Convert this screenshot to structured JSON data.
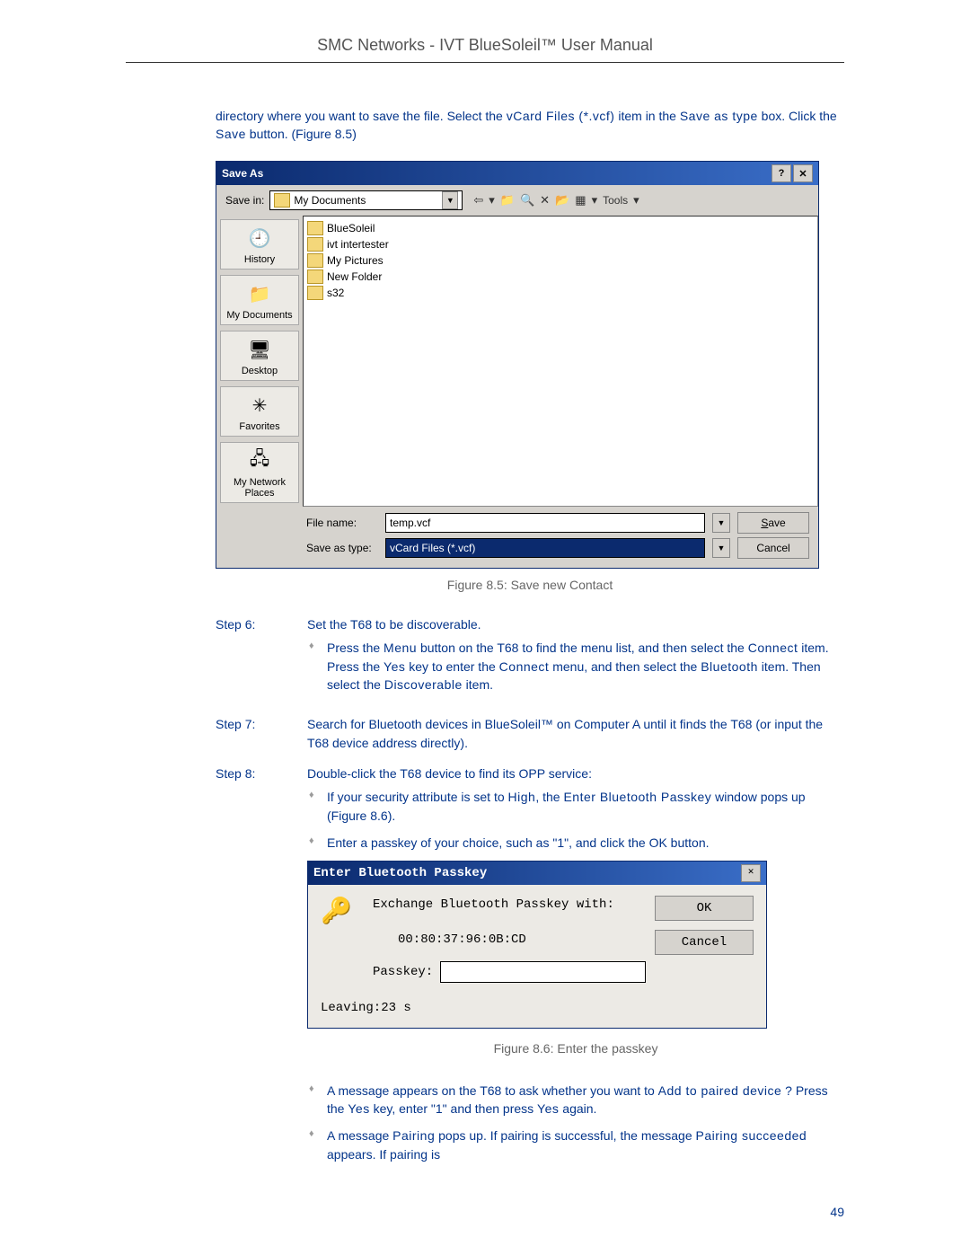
{
  "header": {
    "title": "SMC Networks - IVT BlueSoleil™ User Manual"
  },
  "intro": {
    "line1_a": "directory where you want to save the file. Select the ",
    "line1_b": "vCard Files (*.vcf)",
    "line1_c": " item in the ",
    "line1_d": "Save as type",
    "line1_e": " box. Click the ",
    "line1_f": "Save",
    "line1_g": " button. (Figure 8.5)"
  },
  "saveas": {
    "title": "Save As",
    "help": "?",
    "close": "✕",
    "savein_label": "Save in:",
    "savein_value": "My Documents",
    "tools_label": "Tools",
    "places": [
      "History",
      "My Documents",
      "Desktop",
      "Favorites",
      "My Network Places"
    ],
    "place_icons": [
      "🕘",
      "📁",
      "🖥",
      "✳",
      "🖧"
    ],
    "files": [
      "BlueSoleil",
      "ivt intertester",
      "My Pictures",
      "New Folder",
      "s32"
    ],
    "filename_label": "File name:",
    "filename_value": "temp.vcf",
    "saveastype_label": "Save as type:",
    "saveastype_value": "vCard Files (*.vcf)",
    "save_btn": "Save",
    "cancel_btn": "Cancel"
  },
  "fig85": "Figure 8.5: Save new Contact",
  "step6": {
    "label": "Step 6:",
    "text": "Set the T68 to be discoverable.",
    "b1_a": "Press the ",
    "b1_b": "Menu",
    "b1_c": " button on the T68 to find the menu list, and then select the ",
    "b1_d": "Connect",
    "b1_e": " item. Press the ",
    "b1_f": "Yes",
    "b1_g": " key to enter the ",
    "b1_h": "Connect",
    "b1_i": " menu, and then select the ",
    "b1_j": "Bluetooth",
    "b1_k": " item. Then select the ",
    "b1_l": "Discoverable",
    "b1_m": " item."
  },
  "step7": {
    "label": "Step 7:",
    "text": "Search for Bluetooth devices in BlueSoleil™ on Computer A until it finds the T68 (or input the T68 device address directly)."
  },
  "step8": {
    "label": "Step 8:",
    "text": "Double-click the T68 device to find its OPP service:",
    "b1_a": "If your security attribute is set to ",
    "b1_b": "High",
    "b1_c": ", the ",
    "b1_d": "Enter Bluetooth Passkey",
    "b1_e": " window pops up (Figure 8.6).",
    "b2": "Enter a passkey of your choice, such as \"1\", and click the OK button."
  },
  "passkey": {
    "title": "Enter Bluetooth Passkey",
    "close": "✕",
    "exchange": "Exchange Bluetooth Passkey with:",
    "mac": "00:80:37:96:0B:CD",
    "passkey_label": "Passkey:",
    "leaving": "Leaving:23 s",
    "ok": "OK",
    "cancel": "Cancel"
  },
  "fig86": "Figure 8.6: Enter the passkey",
  "post": {
    "b1_a": "A message appears on the T68 to ask whether you want to ",
    "b1_b": "Add to paired device",
    "b1_c": " ? Press the ",
    "b1_d": "Yes",
    "b1_e": " key, enter \"1\" and then press ",
    "b1_f": "Yes",
    "b1_g": " again.",
    "b2_a": "A message ",
    "b2_b": "Pairing",
    "b2_c": " pops up. If pairing is successful, the message ",
    "b2_d": "Pairing succeeded",
    "b2_e": " appears. If pairing is"
  },
  "pagenum": "49"
}
